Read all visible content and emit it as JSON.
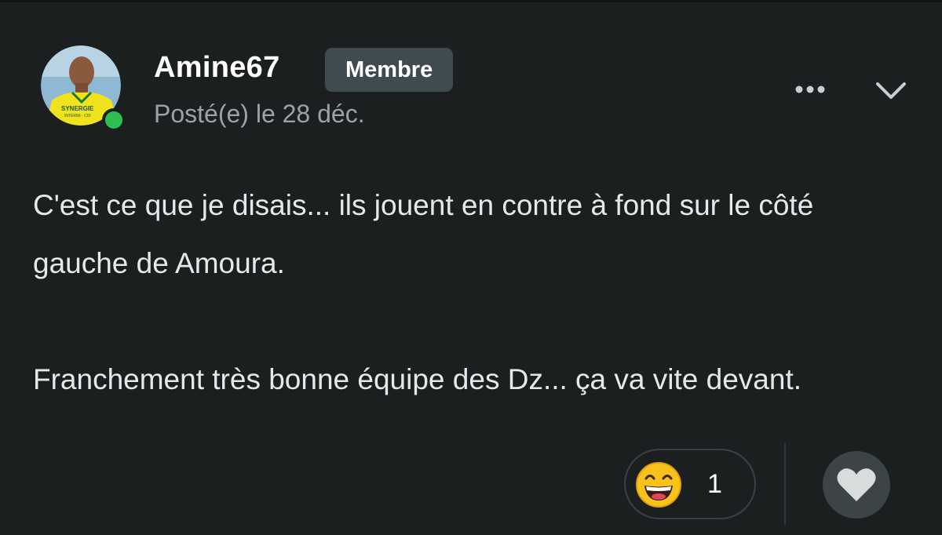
{
  "post": {
    "author": "Amine67",
    "role_badge": "Membre",
    "posted": "Posté(e) le 28 déc.",
    "body": [
      "C'est ce que je disais... ils jouent en contre à fond sur le côté gauche de Amoura.",
      "Franchement très bonne équipe des Dz... ça va vite devant."
    ],
    "status": "online"
  },
  "avatar": {
    "jersey_text_1": "SYNERGIE",
    "jersey_text_2": "INTERIM · CDI"
  },
  "actions": {
    "more_icon": "more-horizontal-icon",
    "collapse_icon": "chevron-down-icon",
    "like_icon": "heart-icon"
  },
  "reactions": {
    "emoji": "grinning-face-icon",
    "count": "1"
  },
  "colors": {
    "background": "#1b1f20",
    "badge": "#3f4b4f",
    "online": "#2fbf4f",
    "muted_text": "#9ba3a6"
  }
}
